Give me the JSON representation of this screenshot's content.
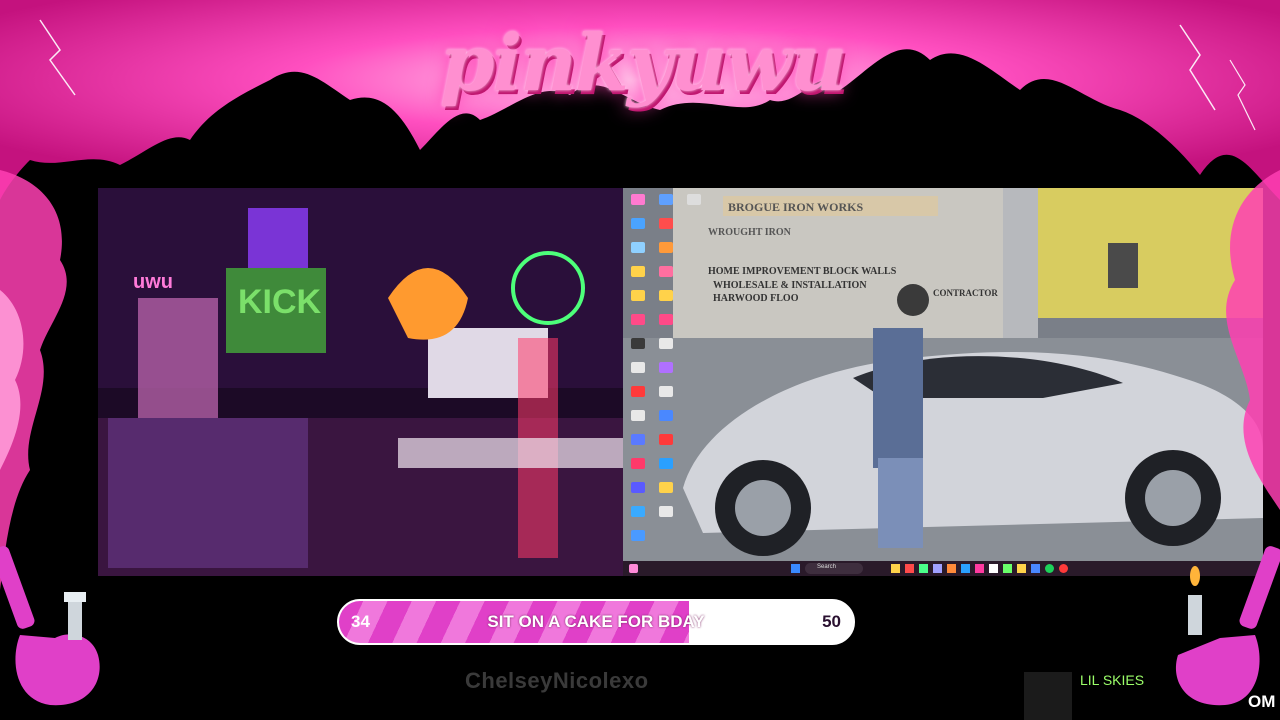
{
  "stream": {
    "channel_logo_text": "pinkyuwu"
  },
  "goal": {
    "current": "34",
    "title": "SIT ON A CAKE FOR BDAY",
    "target": "50",
    "progress": 0.68
  },
  "chat_overlay": {
    "ghost_username": "ChelseyNicolexo"
  },
  "now_playing": {
    "artist": "LIL SKIES",
    "cut_text": "OM"
  },
  "game_scene": {
    "sign_line1": "BROGUE IRON WORKS",
    "sign_line2": "WROUGHT IRON",
    "sign_line3": "HOME IMPROVEMENT    BLOCK WALLS",
    "sign_line4": "WHOLESALE & INSTALLATION",
    "sign_line5": "HARWOOD FLOO",
    "sign_line6": "CONTRACTOR",
    "taskbar_search": "Search"
  },
  "webcam_scene": {
    "neon_sign": "uwu",
    "kick_sign": "KICK"
  },
  "colors": {
    "accent_pink": "#ff2fb0",
    "goal_fill": "#e040c8",
    "artist_green": "#9cff6a"
  }
}
